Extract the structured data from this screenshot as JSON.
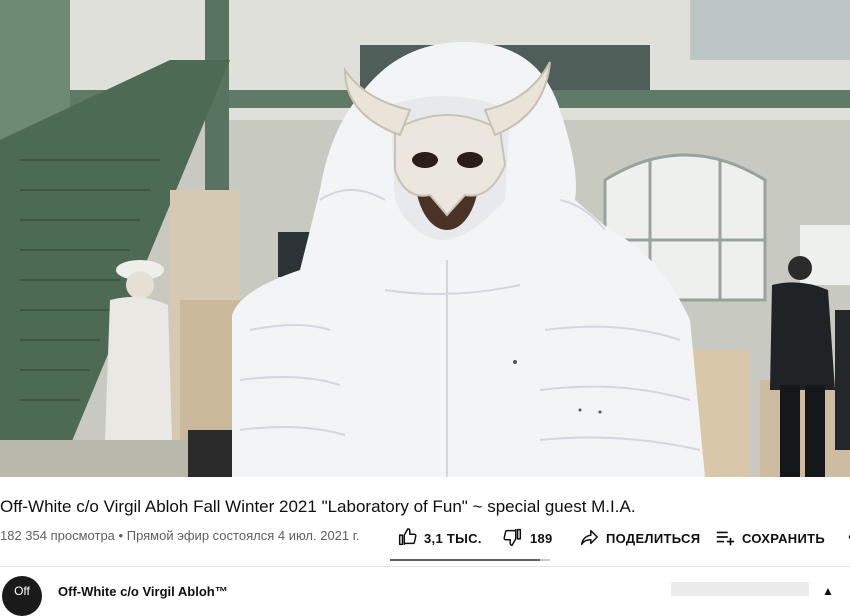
{
  "video": {
    "title": "Off-White c/o Virgil Abloh Fall Winter 2021 \"Laboratory of Fun\" ~ special guest M.I.A."
  },
  "meta": {
    "views": "182 354 просмотра",
    "separator": "•",
    "live_info": "Прямой эфир состоялся 4 июл. 2021 г."
  },
  "actions": {
    "like_count": "3,1 ТЫС.",
    "dislike_count": "189",
    "share_label": "ПОДЕЛИТЬСЯ",
    "save_label": "СОХРАНИТЬ",
    "more_label": "···",
    "like_ratio": 0.94
  },
  "channel": {
    "avatar_text": "Off",
    "name": "Off-White c/o Virgil Abloh™"
  },
  "icons": {
    "like": "thumbs-up-icon",
    "dislike": "thumbs-down-icon",
    "share": "share-arrow-icon",
    "save": "playlist-add-icon",
    "more": "more-horizontal-icon",
    "expand": "chevron-up-icon"
  },
  "colors": {
    "text_primary": "#0f0f0f",
    "text_secondary": "#606060",
    "sentiment_fill": "#606060",
    "sentiment_track": "#cccccc"
  }
}
